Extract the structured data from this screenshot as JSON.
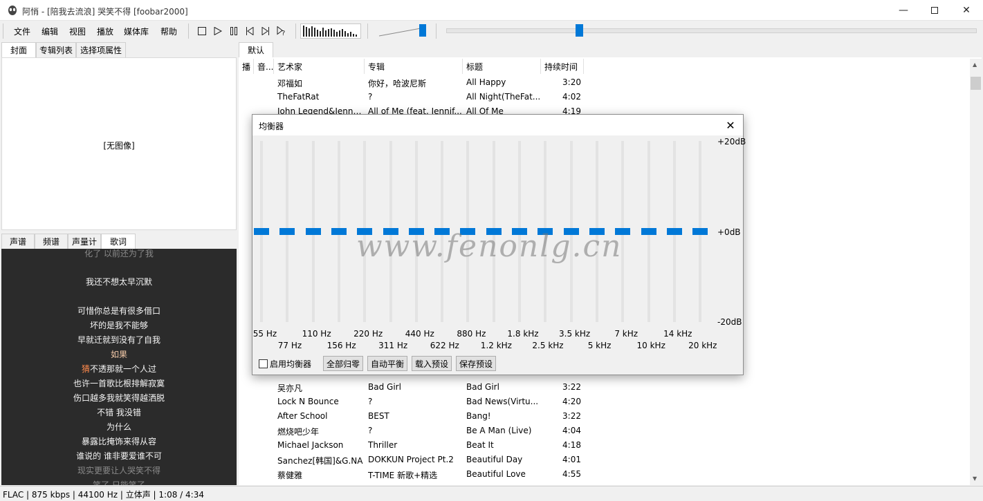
{
  "window": {
    "title": "阿悄 - [陪我去流浪] 哭笑不得  [foobar2000]",
    "minimize_icon": "minimize-icon",
    "maximize_icon": "maximize-icon",
    "close_icon": "close-icon"
  },
  "menu": [
    "文件",
    "编辑",
    "视图",
    "播放",
    "媒体库",
    "帮助"
  ],
  "toolbar": {
    "buttons": [
      "stop-icon",
      "play-icon",
      "pause-icon",
      "previous-icon",
      "next-icon",
      "random-icon"
    ],
    "visualizer_bars": [
      16,
      14,
      12,
      15,
      13,
      10,
      8,
      13,
      9,
      11,
      12,
      10,
      7,
      9,
      11,
      8,
      5,
      7,
      4,
      3
    ],
    "volume_level": 1.0,
    "seek_position": 0.245
  },
  "left_tabs_top": [
    "封面",
    "专辑列表",
    "选择项属性"
  ],
  "cover": {
    "placeholder": "[无图像]"
  },
  "left_tabs_bottom": [
    "声谱",
    "频谱",
    "声量计",
    "歌词"
  ],
  "lyrics": {
    "lines": [
      "化了 以前还为了我",
      "",
      "我还不想太早沉默",
      "",
      "可惜你总是有很多借口",
      "坏的是我不能够",
      "早就迁就到没有了自我",
      "如果",
      "猜不透那就一个人过",
      "也许一首歌比根排解寂寞",
      "伤口越多我就笑得越洒脱",
      "不错 我没错",
      "为什么",
      "暴露比掩饰来得从容",
      "谁说的 谁非要爱谁不可",
      "现实更要让人哭笑不得",
      "笑了 只能笑了"
    ],
    "current_line_prefix": "猜",
    "current_line_rest": "不透那就一个人过"
  },
  "playlist": {
    "tab": "默认",
    "columns": [
      "播",
      "音...",
      "艺术家",
      "专辑",
      "标题",
      "持续时间"
    ],
    "rows_top": [
      {
        "artist": "邓福如",
        "album": "你好，哈波尼斯",
        "title": "All Happy",
        "duration": "3:20"
      },
      {
        "artist": "TheFatRat",
        "album": "?",
        "title": "All Night(TheFat...",
        "duration": "4:02"
      },
      {
        "artist": "John Legend&Jenni...",
        "album": "All of Me (feat. Jennif...",
        "title": "All Of Me",
        "duration": "4:19"
      }
    ],
    "rows_bottom": [
      {
        "artist": "吴亦凡",
        "album": "Bad Girl",
        "title": "Bad Girl",
        "duration": "3:22"
      },
      {
        "artist": "Lock N Bounce",
        "album": "?",
        "title": "Bad News(Virtu...",
        "duration": "4:20"
      },
      {
        "artist": "After School",
        "album": "BEST",
        "title": "Bang!",
        "duration": "3:22"
      },
      {
        "artist": "燃烧吧少年",
        "album": "?",
        "title": "Be A Man (Live)",
        "duration": "4:04"
      },
      {
        "artist": "Michael Jackson",
        "album": "Thriller",
        "title": "Beat It",
        "duration": "4:18"
      },
      {
        "artist": "Sanchez[韩国]&G.NA",
        "album": "DOKKUN Project Pt.2",
        "title": "Beautiful Day",
        "duration": "4:01"
      },
      {
        "artist": "蔡健雅",
        "album": "T-TIME 新歌+精选",
        "title": "Beautiful Love",
        "duration": "4:55"
      }
    ]
  },
  "status": "FLAC | 875 kbps | 44100 Hz | 立体声 | 1:08 / 4:34",
  "equalizer": {
    "title": "均衡器",
    "db_top": "+20dB",
    "db_mid": "+0dB",
    "db_bottom": "-20dB",
    "bands_top_row": [
      "55 Hz",
      "110 Hz",
      "220 Hz",
      "440 Hz",
      "880 Hz",
      "1.8 kHz",
      "3.5 kHz",
      "7 kHz",
      "14 kHz"
    ],
    "bands_bottom_row": [
      "77 Hz",
      "156 Hz",
      "311 Hz",
      "622 Hz",
      "1.2 kHz",
      "2.5 kHz",
      "5 kHz",
      "10 kHz",
      "20 kHz"
    ],
    "gains_db": [
      0,
      0,
      0,
      0,
      0,
      0,
      0,
      0,
      0,
      0,
      0,
      0,
      0,
      0,
      0,
      0,
      0,
      0
    ],
    "enable_label": "启用均衡器",
    "buttons": [
      "全部归零",
      "自动平衡",
      "载入预设",
      "保存预设"
    ]
  },
  "watermark": "www.fenonlg.cn",
  "colors": {
    "accent": "#0078d7",
    "lyrics_bg": "#2b2b2b",
    "lyrics_highlight": "#ff8a4c"
  }
}
